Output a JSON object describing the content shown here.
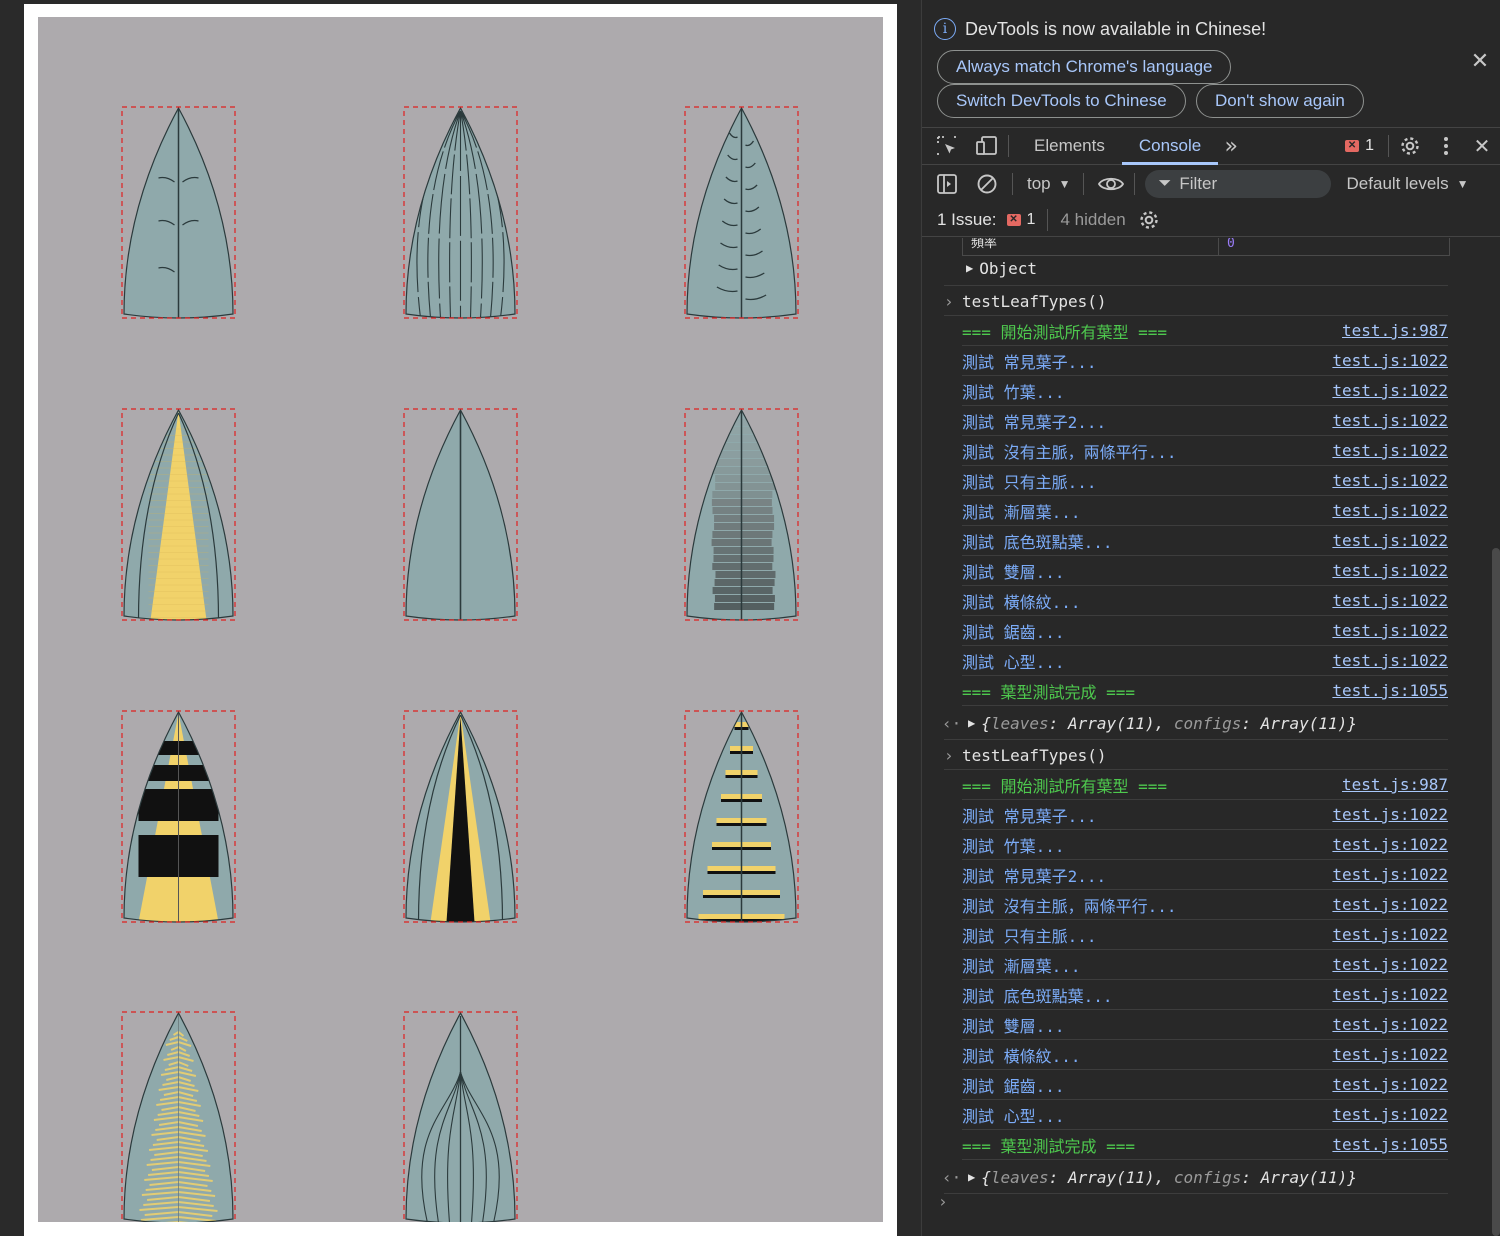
{
  "leaves": [
    {
      "type": "common",
      "veins": "branching"
    },
    {
      "type": "bamboo",
      "veins": "parallel"
    },
    {
      "type": "common2",
      "veins": "comb"
    },
    {
      "type": "no-midrib-two-parallel",
      "fill": "#f1d26a"
    },
    {
      "type": "midrib-only"
    },
    {
      "type": "gradient"
    },
    {
      "type": "base-spots",
      "fill": "#f1d26a"
    },
    {
      "type": "double-layer",
      "fill": "#f1d26a"
    },
    {
      "type": "horizontal-stripes"
    },
    {
      "type": "serrated",
      "fill": "#f1d26a"
    },
    {
      "type": "heart",
      "veins": "arched"
    }
  ],
  "colors": {
    "canvas_bg": "#adaaad",
    "leaf_fill": "#8fa9ab",
    "leaf_stroke": "#2b3a3c",
    "bbox": "#e02020",
    "accent_yellow": "#f1d26a"
  },
  "devtools": {
    "banner": {
      "message": "DevTools is now available in Chinese!",
      "btn_match": "Always match Chrome's language",
      "btn_switch": "Switch DevTools to Chinese",
      "btn_dont_show": "Don't show again"
    },
    "tabs": {
      "elements": "Elements",
      "console": "Console",
      "more": "»",
      "error_count": "1"
    },
    "toolbar": {
      "context": "top",
      "filter_placeholder": "Filter",
      "levels": "Default levels"
    },
    "issues": {
      "label": "1 Issue:",
      "count": "1",
      "hidden": "4 hidden"
    },
    "console": {
      "truncated_row": "頻率",
      "truncated_value": "0",
      "object_label": "Object",
      "groups": [
        {
          "command": "testLeafTypes()",
          "lines": [
            {
              "msg": "=== 開始測試所有葉型 ===",
              "src": "test.js:987",
              "green": true
            },
            {
              "msg": "測試 常見葉子...",
              "src": "test.js:1022"
            },
            {
              "msg": "測試 竹葉...",
              "src": "test.js:1022"
            },
            {
              "msg": "測試 常見葉子2...",
              "src": "test.js:1022"
            },
            {
              "msg": "測試 沒有主脈，兩條平行...",
              "src": "test.js:1022"
            },
            {
              "msg": "測試 只有主脈...",
              "src": "test.js:1022"
            },
            {
              "msg": "測試 漸層葉...",
              "src": "test.js:1022"
            },
            {
              "msg": "測試 底色斑點葉...",
              "src": "test.js:1022"
            },
            {
              "msg": "測試 雙層...",
              "src": "test.js:1022"
            },
            {
              "msg": "測試 橫條紋...",
              "src": "test.js:1022"
            },
            {
              "msg": "測試 鋸齒...",
              "src": "test.js:1022"
            },
            {
              "msg": "測試 心型...",
              "src": "test.js:1022"
            },
            {
              "msg": "=== 葉型測試完成 ===",
              "src": "test.js:1055",
              "green": true
            }
          ],
          "result": {
            "k1": "leaves",
            "v1": "Array(11)",
            "k2": "configs",
            "v2": "Array(11)"
          }
        },
        {
          "command": "testLeafTypes()",
          "lines": [
            {
              "msg": "=== 開始測試所有葉型 ===",
              "src": "test.js:987",
              "green": true
            },
            {
              "msg": "測試 常見葉子...",
              "src": "test.js:1022"
            },
            {
              "msg": "測試 竹葉...",
              "src": "test.js:1022"
            },
            {
              "msg": "測試 常見葉子2...",
              "src": "test.js:1022"
            },
            {
              "msg": "測試 沒有主脈，兩條平行...",
              "src": "test.js:1022"
            },
            {
              "msg": "測試 只有主脈...",
              "src": "test.js:1022"
            },
            {
              "msg": "測試 漸層葉...",
              "src": "test.js:1022"
            },
            {
              "msg": "測試 底色斑點葉...",
              "src": "test.js:1022"
            },
            {
              "msg": "測試 雙層...",
              "src": "test.js:1022"
            },
            {
              "msg": "測試 橫條紋...",
              "src": "test.js:1022"
            },
            {
              "msg": "測試 鋸齒...",
              "src": "test.js:1022"
            },
            {
              "msg": "測試 心型...",
              "src": "test.js:1022"
            },
            {
              "msg": "=== 葉型測試完成 ===",
              "src": "test.js:1055",
              "green": true
            }
          ],
          "result": {
            "k1": "leaves",
            "v1": "Array(11)",
            "k2": "configs",
            "v2": "Array(11)"
          }
        }
      ],
      "prompt": "›"
    }
  }
}
